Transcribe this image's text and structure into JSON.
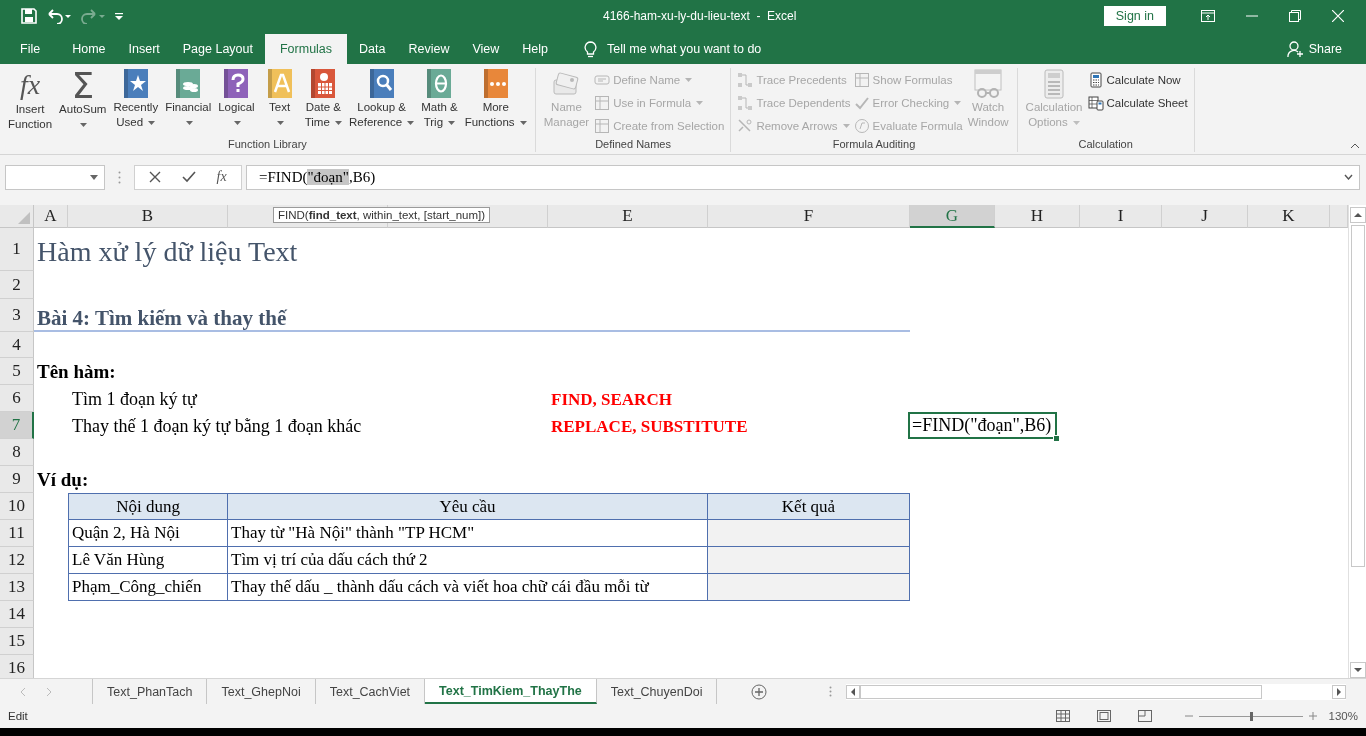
{
  "window": {
    "title": "4166-ham-xu-ly-du-lieu-text  -  Excel",
    "sign_in": "Sign in"
  },
  "quick_access": [
    {
      "kind": "save"
    },
    {
      "kind": "undo"
    },
    {
      "kind": "redo",
      "disabled": true
    },
    {
      "kind": "customize"
    }
  ],
  "tabs": [
    {
      "label": "File",
      "selected": false
    },
    {
      "label": "Home",
      "selected": false
    },
    {
      "label": "Insert",
      "selected": false
    },
    {
      "label": "Page Layout",
      "selected": false
    },
    {
      "label": "Formulas",
      "selected": true
    },
    {
      "label": "Data",
      "selected": false
    },
    {
      "label": "Review",
      "selected": false
    },
    {
      "label": "View",
      "selected": false
    },
    {
      "label": "Help",
      "selected": false
    }
  ],
  "tell_me": {
    "placeholder": "Tell me what you want to do"
  },
  "share": "Share",
  "ribbon": {
    "groups": [
      {
        "label": "Function Library",
        "items": [
          {
            "kind": "large",
            "glyph": "fx",
            "lines": [
              "Insert",
              "Function"
            ],
            "dropdown": false,
            "disabled": false
          },
          {
            "kind": "large",
            "glyph": "Σ",
            "lines": [
              "AutoSum"
            ],
            "dropdown": true,
            "disabled": false
          },
          {
            "kind": "large",
            "lines": [
              "Recently",
              "Used"
            ],
            "dropdown": true,
            "disabled": false
          },
          {
            "kind": "large",
            "lines": [
              "Financial"
            ],
            "dropdown": true,
            "disabled": false
          },
          {
            "kind": "large",
            "lines": [
              "Logical"
            ],
            "dropdown": true,
            "disabled": false
          },
          {
            "kind": "large",
            "lines": [
              "Text"
            ],
            "dropdown": true,
            "disabled": false
          },
          {
            "kind": "large",
            "lines": [
              "Date &",
              "Time"
            ],
            "dropdown": true,
            "disabled": false
          },
          {
            "kind": "large",
            "lines": [
              "Lookup &",
              "Reference"
            ],
            "dropdown": true,
            "disabled": false
          },
          {
            "kind": "large",
            "lines": [
              "Math &",
              "Trig"
            ],
            "dropdown": true,
            "disabled": false
          },
          {
            "kind": "large",
            "lines": [
              "More",
              "Functions"
            ],
            "dropdown": true,
            "disabled": false
          }
        ]
      },
      {
        "label": "Defined Names",
        "items": [
          {
            "kind": "large",
            "lines": [
              "Name",
              "Manager"
            ],
            "dropdown": false,
            "disabled": true
          },
          {
            "kind": "stack",
            "buttons": [
              {
                "label": "Define Name",
                "dropdown": true,
                "disabled": true
              },
              {
                "label": "Use in Formula",
                "dropdown": true,
                "disabled": true
              },
              {
                "label": "Create from Selection",
                "dropdown": false,
                "disabled": true
              }
            ]
          }
        ]
      },
      {
        "label": "Formula Auditing",
        "items": [
          {
            "kind": "stack",
            "buttons": [
              {
                "label": "Trace Precedents",
                "dropdown": false,
                "disabled": true
              },
              {
                "label": "Trace Dependents",
                "dropdown": false,
                "disabled": true
              },
              {
                "label": "Remove Arrows",
                "dropdown": true,
                "disabled": true
              }
            ]
          },
          {
            "kind": "stack",
            "buttons": [
              {
                "label": "Show Formulas",
                "dropdown": false,
                "disabled": true
              },
              {
                "label": "Error Checking",
                "dropdown": true,
                "disabled": true
              },
              {
                "label": "Evaluate Formula",
                "dropdown": false,
                "disabled": true
              }
            ]
          },
          {
            "kind": "large",
            "lines": [
              "Watch",
              "Window"
            ],
            "dropdown": false,
            "disabled": true
          }
        ]
      },
      {
        "label": "Calculation",
        "items": [
          {
            "kind": "large",
            "lines": [
              "Calculation",
              "Options"
            ],
            "dropdown": true,
            "disabled": true
          },
          {
            "kind": "stack",
            "buttons": [
              {
                "label": "Calculate Now",
                "dropdown": false,
                "disabled": false
              },
              {
                "label": "Calculate Sheet",
                "dropdown": false,
                "disabled": false
              }
            ]
          }
        ]
      }
    ]
  },
  "formula_bar": {
    "fx": "fx",
    "before": "=FIND(",
    "selected": "\"đoạn\"",
    "after": ",B6)"
  },
  "tooltip": "FIND(**find_text**, within_text, [start_num])",
  "column_headers": [
    {
      "letter": "A",
      "selected": false
    },
    {
      "letter": "B",
      "selected": false
    },
    {
      "selected": false
    },
    {
      "selected": false
    },
    {
      "letter": "E",
      "selected": false
    },
    {
      "letter": "F",
      "selected": false
    },
    {
      "letter": "G",
      "selected": true
    },
    {
      "letter": "H",
      "selected": false
    },
    {
      "letter": "I",
      "selected": false
    },
    {
      "letter": "J",
      "selected": false
    },
    {
      "letter": "K",
      "selected": false
    }
  ],
  "rows": [
    {
      "number": "1",
      "selected": false,
      "kind": "text",
      "cells": [
        {
          "kind": "title",
          "text": "Hàm xử lý dữ liệu Text",
          "selected": false
        }
      ]
    },
    {
      "number": "2",
      "selected": false,
      "kind": "text",
      "cells": []
    },
    {
      "number": "3",
      "selected": false,
      "kind": "text",
      "cells": [
        {
          "kind": "heading",
          "text": "Bài 4: Tìm kiếm và thay thế",
          "selected": false
        }
      ]
    },
    {
      "number": "4",
      "selected": false,
      "kind": "text",
      "cells": []
    },
    {
      "number": "5",
      "selected": false,
      "kind": "text",
      "cells": [
        {
          "kind": "label",
          "text": "Tên hàm:",
          "selected": false
        }
      ]
    },
    {
      "number": "6",
      "selected": false,
      "kind": "text",
      "cells": [
        {
          "kind": "item",
          "text": "Tìm 1 đoạn ký tự",
          "selected": false
        },
        {
          "kind": "function",
          "text": "FIND, SEARCH",
          "selected": false
        }
      ]
    },
    {
      "number": "7",
      "selected": true,
      "kind": "text",
      "cells": [
        {
          "kind": "item",
          "text": "Thay thế 1 đoạn ký tự bằng 1 đoạn khác",
          "selected": false
        },
        {
          "kind": "function",
          "text": "REPLACE, SUBSTITUTE",
          "selected": false
        },
        {
          "kind": "entry",
          "text": "=FIND(\"đoạn\",B6)",
          "selected": true
        }
      ]
    },
    {
      "number": "8",
      "selected": false,
      "kind": "text",
      "cells": []
    },
    {
      "number": "9",
      "selected": false,
      "kind": "text",
      "cells": [
        {
          "kind": "label",
          "text": "Ví dụ:",
          "selected": false
        }
      ]
    },
    {
      "number": "10",
      "selected": false,
      "kind": "table_header",
      "cells": [
        "Nội dung",
        "Yêu cầu",
        "Kết quả"
      ]
    },
    {
      "number": "11",
      "selected": false,
      "kind": "table_row",
      "cells": [
        "Quận 2, Hà Nội",
        "Thay từ \"Hà Nội\" thành \"TP HCM\""
      ]
    },
    {
      "number": "12",
      "selected": false,
      "kind": "table_row",
      "cells": [
        "Lê Văn Hùng",
        "Tìm vị trí của dấu cách thứ 2"
      ]
    },
    {
      "number": "13",
      "selected": false,
      "kind": "table_row",
      "cells": [
        "Phạm_Công_chiến",
        "Thay thế dấu _ thành dấu cách và viết hoa chữ cái đầu mỗi từ"
      ]
    },
    {
      "number": "14",
      "selected": false,
      "kind": "text",
      "cells": []
    },
    {
      "number": "15",
      "selected": false,
      "kind": "text",
      "cells": []
    },
    {
      "number": "16",
      "selected": false,
      "kind": "text",
      "cells": []
    }
  ],
  "sheet_tabs": [
    {
      "label": "Text_PhanTach",
      "selected": false
    },
    {
      "label": "Text_GhepNoi",
      "selected": false
    },
    {
      "label": "Text_CachViet",
      "selected": false
    },
    {
      "label": "Text_TimKiem_ThayThe",
      "selected": true
    },
    {
      "label": "Text_ChuyenDoi",
      "selected": false
    }
  ],
  "status_bar": {
    "mode": "Edit",
    "views": [
      {
        "kind": "normal"
      },
      {
        "kind": "page_layout"
      },
      {
        "kind": "page_break"
      }
    ],
    "zoom": {
      "level": 0.5,
      "reading": "130%"
    }
  }
}
